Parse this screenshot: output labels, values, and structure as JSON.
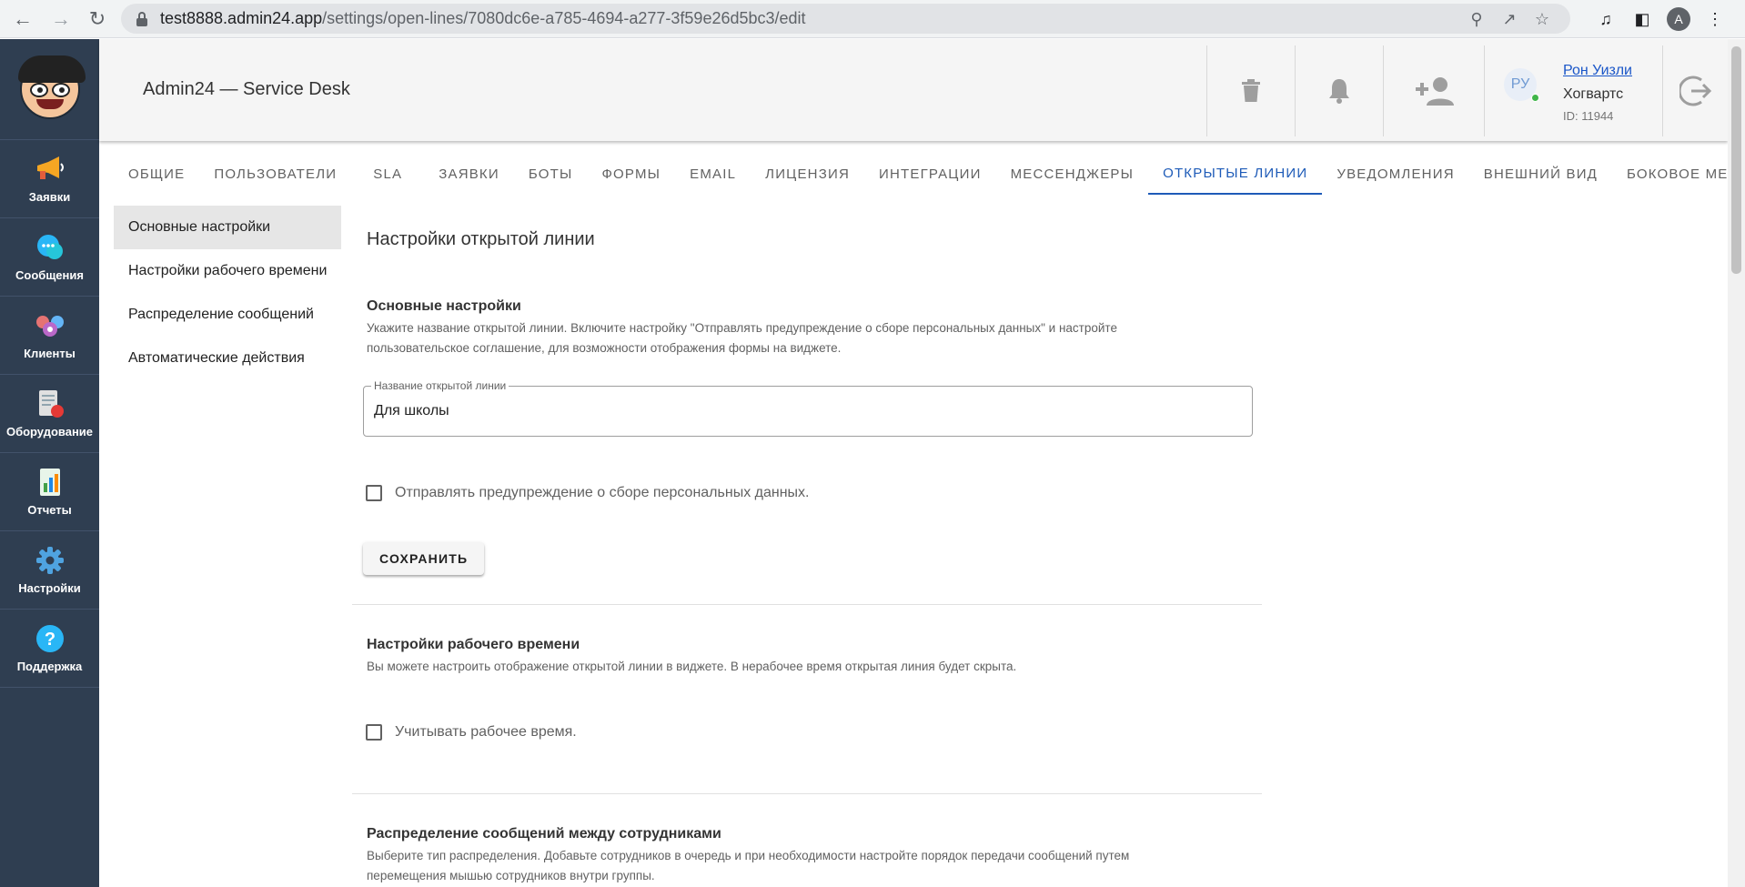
{
  "browser": {
    "url_host": "test8888.admin24.app",
    "url_path": "/settings/open-lines/7080dc6e-a785-4694-a277-3f59e26d5bc3/edit",
    "profile_initial": "A"
  },
  "sidebar": {
    "items": [
      {
        "label": "Заявки",
        "icon": "megaphone-icon"
      },
      {
        "label": "Сообщения",
        "icon": "chat-bubble-icon"
      },
      {
        "label": "Клиенты",
        "icon": "clients-icon"
      },
      {
        "label": "Оборудование",
        "icon": "equipment-icon"
      },
      {
        "label": "Отчеты",
        "icon": "report-chart-icon"
      },
      {
        "label": "Настройки",
        "icon": "gear-icon"
      },
      {
        "label": "Поддержка",
        "icon": "help-question-icon"
      }
    ]
  },
  "header": {
    "title": "Admin24 — Service Desk",
    "user": {
      "initials": "РУ",
      "name": "Рон Уизли",
      "org": "Хогвартс",
      "id": "ID: 11944"
    }
  },
  "tabs": [
    {
      "label": "ОБЩИЕ"
    },
    {
      "label": "ПОЛЬЗОВАТЕЛИ"
    },
    {
      "label": "SLA"
    },
    {
      "label": "ЗАЯВКИ"
    },
    {
      "label": "БОТЫ"
    },
    {
      "label": "ФОРМЫ"
    },
    {
      "label": "EMAIL"
    },
    {
      "label": "ЛИЦЕНЗИЯ"
    },
    {
      "label": "ИНТЕГРАЦИИ"
    },
    {
      "label": "МЕССЕНДЖЕРЫ"
    },
    {
      "label": "ОТКРЫТЫЕ ЛИНИИ",
      "active": true
    },
    {
      "label": "УВЕДОМЛЕНИЯ"
    },
    {
      "label": "ВНЕШНИЙ ВИД"
    },
    {
      "label": "БОКОВОЕ МЕНЮ"
    }
  ],
  "subnav": [
    {
      "label": "Основные настройки",
      "active": true
    },
    {
      "label": "Настройки рабочего времени"
    },
    {
      "label": "Распределение сообщений"
    },
    {
      "label": "Автоматические действия"
    }
  ],
  "main": {
    "page_title": "Настройки открытой линии",
    "basic": {
      "title": "Основные настройки",
      "desc": "Укажите название открытой линии. Включите настройку \"Отправлять предупреждение о сборе персональных данных\" и настройте пользовательское соглашение, для возможности отображения формы на виджете.",
      "field_label": "Название открытой линии",
      "field_value": "Для школы",
      "checkbox_label": "Отправлять предупреждение о сборе персональных данных.",
      "save_label": "СОХРАНИТЬ"
    },
    "worktime": {
      "title": "Настройки рабочего времени",
      "desc": "Вы можете настроить отображение открытой линии в виджете. В нерабочее время открытая линия будет скрыта.",
      "checkbox_label": "Учитывать рабочее время."
    },
    "distribution": {
      "title": "Распределение сообщений между сотрудниками",
      "desc": "Выберите тип распределения. Добавьте сотрудников в очередь и при необходимости настройте порядок передачи сообщений путем перемещения мышью сотрудников внутри группы."
    }
  }
}
